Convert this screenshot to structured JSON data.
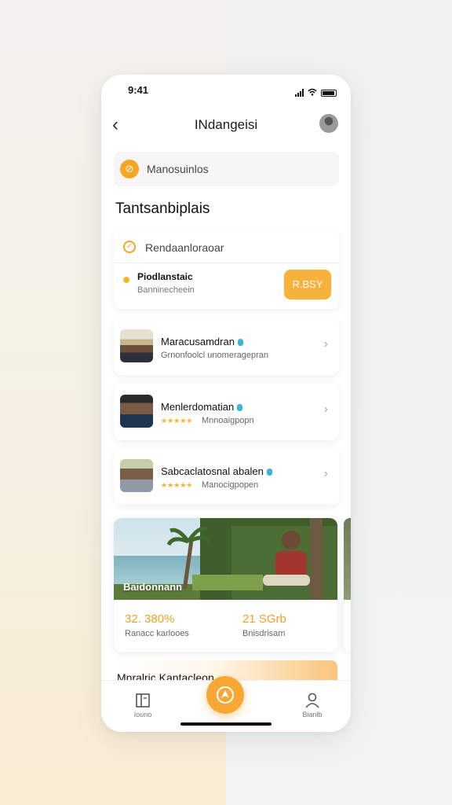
{
  "status_bar": {
    "time": "9:41"
  },
  "header": {
    "title": "INdangeisi"
  },
  "search": {
    "placeholder": "Manosuinlos"
  },
  "section": {
    "title": "Tantsanbiplais"
  },
  "highlight_card": {
    "heading": "Rendaanloraoar",
    "item_name": "Piodlanstaic",
    "item_sub": "Banninecheein",
    "button_label": "R.BSY"
  },
  "people": [
    {
      "name": "Maracusamdran",
      "subtitle": "Grnonfoolcl unomeragepran",
      "stars": ""
    },
    {
      "name": "Menlerdomatian",
      "subtitle": "Mnnoaigpopn",
      "stars": "★★★★★"
    },
    {
      "name": "Sabcaclatosnal abalen",
      "subtitle": "Manocigpopen",
      "stars": "★★★★★"
    }
  ],
  "feature": {
    "caption": "Baidonnann",
    "stat1_value": "32. 380%",
    "stat1_label": "Ranacc karlooes",
    "stat2_value": "21 SGrb",
    "stat2_label": "Bnisdrisam"
  },
  "banner": {
    "text": "Mnralric Kantacleon"
  },
  "tabbar": {
    "tab1_label": "Iouno",
    "tab2_label": "Bianlb"
  },
  "colors": {
    "accent": "#f7a733",
    "badge": "#3bb7d6",
    "stars": "#f5b22b"
  }
}
